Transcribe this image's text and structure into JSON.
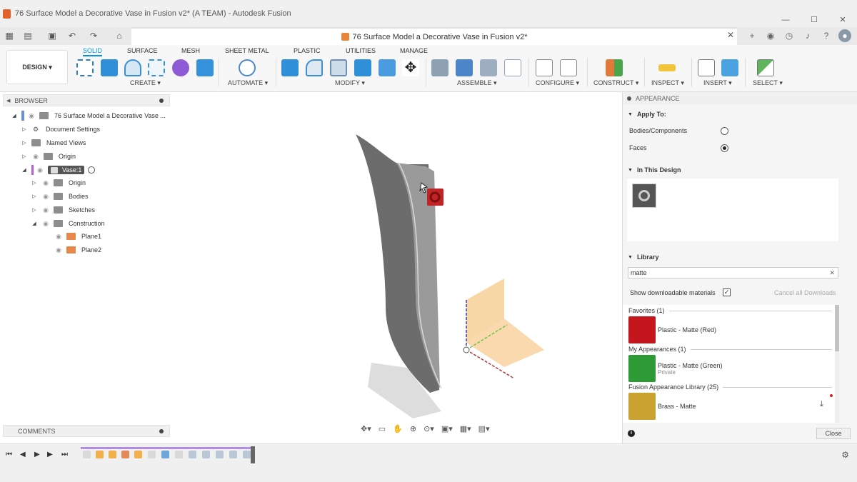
{
  "window": {
    "title": "76 Surface Model a Decorative Vase in Fusion v2* (A TEAM) - Autodesk Fusion",
    "controls": [
      "—",
      "☐",
      "✕"
    ]
  },
  "doc_tab": {
    "title": "76 Surface Model a Decorative Vase in Fusion v2*",
    "close": "✕"
  },
  "ribbon": {
    "workspace": "DESIGN ▾",
    "tabs": [
      "SOLID",
      "SURFACE",
      "MESH",
      "SHEET METAL",
      "PLASTIC",
      "UTILITIES",
      "MANAGE"
    ],
    "active_tab": "SOLID",
    "groups": [
      "CREATE ▾",
      "AUTOMATE ▾",
      "MODIFY ▾",
      "ASSEMBLE ▾",
      "CONFIGURE ▾",
      "CONSTRUCT ▾",
      "INSPECT ▾",
      "INSERT ▾",
      "SELECT ▾"
    ]
  },
  "browser": {
    "title": "BROWSER",
    "items": [
      {
        "label": "76 Surface Model a Decorative Vase ..."
      },
      {
        "label": "Document Settings"
      },
      {
        "label": "Named Views"
      },
      {
        "label": "Origin"
      },
      {
        "label": "Vase:1"
      },
      {
        "label": "Origin"
      },
      {
        "label": "Bodies"
      },
      {
        "label": "Sketches"
      },
      {
        "label": "Construction"
      },
      {
        "label": "Plane1"
      },
      {
        "label": "Plane2"
      }
    ]
  },
  "comments": {
    "title": "COMMENTS"
  },
  "appearance": {
    "title": "APPEARANCE",
    "apply_to": {
      "heading": "Apply To:",
      "options": [
        "Bodies/Components",
        "Faces"
      ],
      "selected": "Faces"
    },
    "in_this_design": "In This Design",
    "library": {
      "heading": "Library",
      "search_value": "matte",
      "clear": "✕",
      "show_downloadable_label": "Show downloadable materials",
      "show_downloadable_checked": "✓",
      "cancel_downloads": "Cancel all Downloads",
      "sections": [
        {
          "heading": "Favorites (1)",
          "items": [
            {
              "name": "Plastic - Matte (Red)",
              "sub": "",
              "color": "#c4161c"
            }
          ]
        },
        {
          "heading": "My Appearances (1)",
          "items": [
            {
              "name": "Plastic - Matte (Green)",
              "sub": "Private",
              "color": "#2e9a35"
            }
          ]
        },
        {
          "heading": "Fusion Appearance Library (25)",
          "items": [
            {
              "name": "Brass - Matte",
              "sub": "",
              "color": "#c9a232"
            }
          ]
        }
      ]
    },
    "close_label": "Close"
  },
  "colors": {
    "accent": "#0696d7",
    "timeline_track": "#b28ee3"
  }
}
